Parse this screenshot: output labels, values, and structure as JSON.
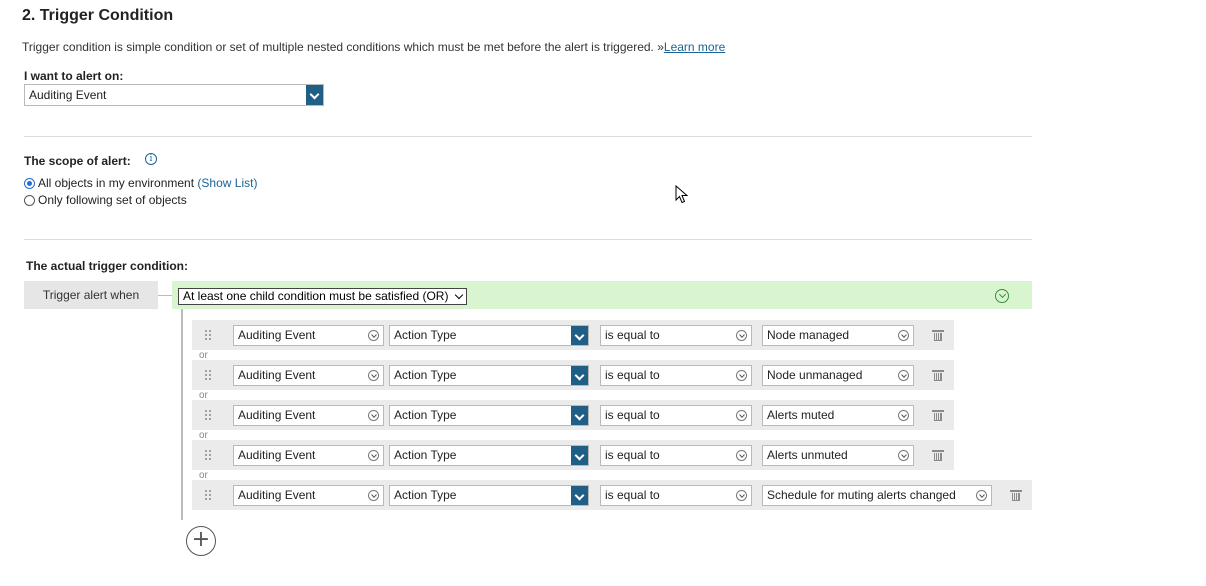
{
  "header": {
    "title": "2. Trigger Condition"
  },
  "description": {
    "text": "Trigger condition is simple condition or set of multiple nested conditions which must be met before the alert is triggered. »",
    "learn_more": "Learn more"
  },
  "alert_on": {
    "label": "I want to alert on:",
    "value": "Auditing Event"
  },
  "scope": {
    "label": "The scope of alert:",
    "option_all": "All objects in my environment",
    "show_list": "(Show List)",
    "option_following": "Only following set of objects",
    "selected": "all"
  },
  "trigger": {
    "label": "The actual trigger condition:",
    "when_label": "Trigger alert when",
    "group_value": "At least one child condition must be satisfied (OR)",
    "or_label": "or",
    "conditions": [
      {
        "object": "Auditing Event",
        "field": "Action Type",
        "operator": "is equal to",
        "value": "Node managed"
      },
      {
        "object": "Auditing Event",
        "field": "Action Type",
        "operator": "is equal to",
        "value": "Node unmanaged"
      },
      {
        "object": "Auditing Event",
        "field": "Action Type",
        "operator": "is equal to",
        "value": "Alerts muted"
      },
      {
        "object": "Auditing Event",
        "field": "Action Type",
        "operator": "is equal to",
        "value": "Alerts unmuted"
      },
      {
        "object": "Auditing Event",
        "field": "Action Type",
        "operator": "is equal to",
        "value": "Schedule for muting alerts changed"
      }
    ],
    "add_symbol": "+"
  },
  "colors": {
    "accent": "#1f5f86",
    "group_bg": "#d9f5cf",
    "row_bg": "#ebebeb",
    "link": "#1a6496"
  }
}
